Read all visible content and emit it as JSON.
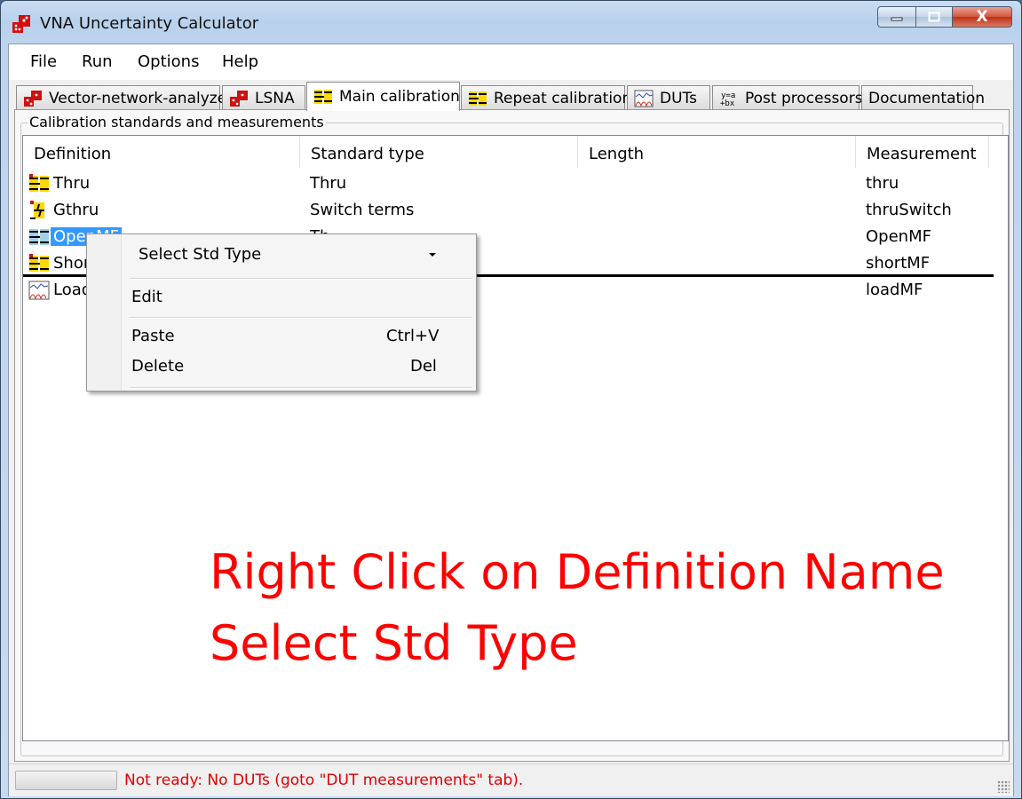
{
  "window": {
    "title": "VNA Uncertainty Calculator",
    "close_label": "X"
  },
  "menu": [
    "File",
    "Run",
    "Options",
    "Help"
  ],
  "tabs": [
    {
      "label": "Vector-network-analyzer",
      "icon": "vna-icon"
    },
    {
      "label": "LSNA",
      "icon": "vna-icon"
    },
    {
      "label": "Main calibration",
      "icon": "calibration-icon",
      "active": true
    },
    {
      "label": "Repeat calibration",
      "icon": "calibration-icon"
    },
    {
      "label": "DUTs",
      "icon": "graph-icon"
    },
    {
      "label": "Post processors",
      "icon": "formula-icon"
    },
    {
      "label": "Documentation",
      "icon": ""
    }
  ],
  "group_label": "Calibration standards and measurements",
  "columns": [
    "Definition",
    "Standard type",
    "Length",
    "Measurement"
  ],
  "rows": [
    {
      "definition": "Thru",
      "type": "Thru",
      "length": "",
      "measurement": "thru",
      "icon": "calibration-icon"
    },
    {
      "definition": "Gthru",
      "type": "Switch terms",
      "length": "",
      "measurement": "thruSwitch",
      "icon": "switch-icon"
    },
    {
      "definition": "OpenMF",
      "type": "Th",
      "length": "",
      "measurement": "OpenMF",
      "icon": "calibration-icon",
      "selected": true
    },
    {
      "definition": "ShortMF",
      "type": "",
      "length": "",
      "measurement": "shortMF",
      "icon": "calibration-icon"
    },
    {
      "definition": "LoadMF",
      "type": "",
      "length": "",
      "measurement": "loadMF",
      "icon": "graph-icon"
    }
  ],
  "context_menu": {
    "select_std_type": "Select Std Type",
    "edit": "Edit",
    "paste": "Paste",
    "paste_shortcut": "Ctrl+V",
    "delete": "Delete",
    "delete_shortcut": "Del"
  },
  "annotation": {
    "line1": "Right Click on Definition Name",
    "line2": "Select Std Type"
  },
  "status": {
    "text": "Not ready: No DUTs (goto \"DUT measurements\" tab)."
  },
  "colors": {
    "selection": "#3399ff",
    "annotation": "#ff0000",
    "status_text": "#e00000"
  }
}
